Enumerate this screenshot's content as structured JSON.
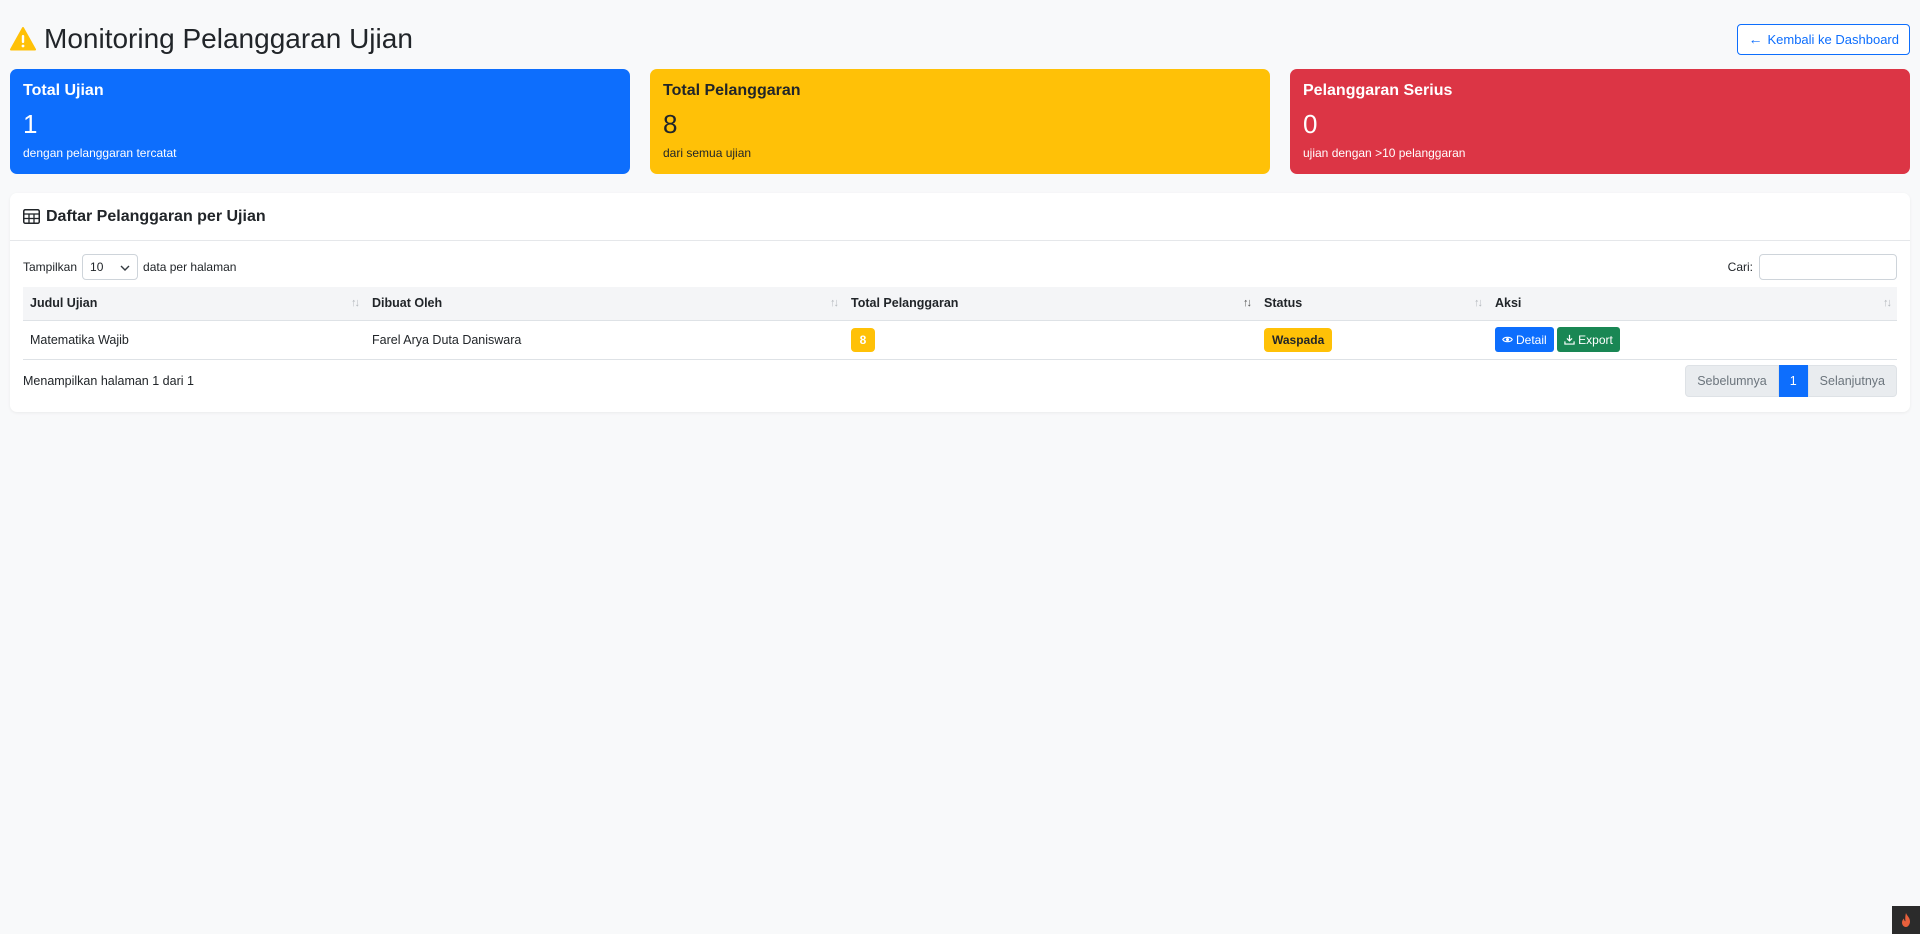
{
  "page": {
    "title": "Monitoring Pelanggaran Ujian",
    "back_button_label": "Kembali ke Dashboard"
  },
  "cards": [
    {
      "title": "Total Ujian",
      "value": "1",
      "subtitle": "dengan pelanggaran tercatat"
    },
    {
      "title": "Total Pelanggaran",
      "value": "8",
      "subtitle": "dari semua ujian"
    },
    {
      "title": "Pelanggaran Serius",
      "value": "0",
      "subtitle": "ujian dengan >10 pelanggaran"
    }
  ],
  "table_card": {
    "title": "Daftar Pelanggaran per Ujian",
    "length_prefix": "Tampilkan",
    "length_value": "10",
    "length_suffix": "data per halaman",
    "search_label": "Cari:",
    "search_value": "",
    "columns": [
      "Judul Ujian",
      "Dibuat Oleh",
      "Total Pelanggaran",
      "Status",
      "Aksi"
    ],
    "rows": [
      {
        "judul": "Matematika Wajib",
        "dibuat_oleh": "Farel Arya Duta Daniswara",
        "total": "8",
        "status": "Waspada",
        "detail_label": "Detail",
        "export_label": "Export"
      }
    ],
    "info": "Menampilkan halaman 1 dari 1",
    "pagination": {
      "prev": "Sebelumnya",
      "current": "1",
      "next": "Selanjutnya"
    }
  },
  "colors": {
    "primary": "#0d6efd",
    "warning": "#ffc107",
    "danger": "#dc3545",
    "success": "#198754"
  }
}
